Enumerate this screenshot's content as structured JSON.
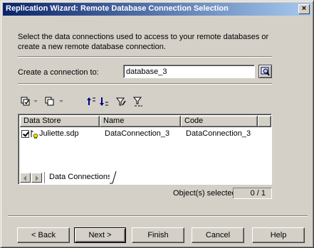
{
  "window": {
    "title": "Replication Wizard: Remote Database Connection Selection",
    "close_glyph": "×"
  },
  "description": [
    "Select the data connections used to access to your remote databases or",
    "create a new remote database connection."
  ],
  "connection": {
    "label": "Create a connection to:",
    "value": "database_3"
  },
  "toolbar": {
    "icons": [
      "select-all-icon",
      "deselect-all-icon",
      "move-up-icon",
      "move-down-icon",
      "filter-icon",
      "clear-filter-icon"
    ]
  },
  "grid": {
    "columns": [
      "Data Store",
      "Name",
      "Code"
    ],
    "rows": [
      {
        "checked": true,
        "data_store": "Juliette.sdp",
        "name": "DataConnection_3",
        "code": "DataConnection_3"
      }
    ],
    "tab": "Data Connections"
  },
  "selection": {
    "label": "Object(s) selected:",
    "value": "0 / 1"
  },
  "buttons": {
    "back": "< Back",
    "next": "Next >",
    "finish": "Finish",
    "cancel": "Cancel",
    "help": "Help"
  },
  "colors": {
    "titlebar_start": "#0a246a",
    "titlebar_end": "#a6caf0",
    "face": "#d4d0c8"
  }
}
